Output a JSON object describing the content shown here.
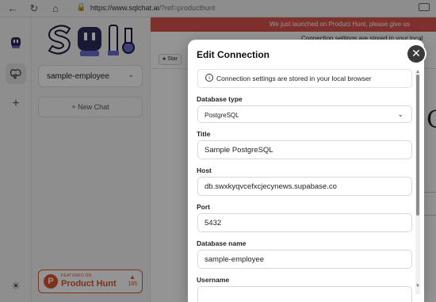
{
  "browser": {
    "url_host": "https://www.sqlchat.ai",
    "url_path": "/?ref=producthunt"
  },
  "sidebar": {
    "database_selector": "sample-employee",
    "new_chat_label": "New Chat"
  },
  "product_hunt": {
    "featured_label": "FEATURED ON",
    "name": "Product Hunt",
    "upvotes": "185"
  },
  "main": {
    "banner_text": "We just launched on Product Hunt, please give us",
    "sub_note": "Connection settings are stored in your local",
    "github_star_label": "Star",
    "background_glyph": "C"
  },
  "modal": {
    "title": "Edit Connection",
    "info_text": "Connection settings are stored in your local browser",
    "fields": {
      "database_type": {
        "label": "Database type",
        "value": "PostgreSQL"
      },
      "title": {
        "label": "Title",
        "value": "Sample PostgreSQL"
      },
      "host": {
        "label": "Host",
        "value": "db.swxkyqvcefxcjecynews.supabase.co"
      },
      "port": {
        "label": "Port",
        "value": "5432"
      },
      "database_name": {
        "label": "Database name",
        "value": "sample-employee"
      },
      "username": {
        "label": "Username"
      }
    }
  },
  "colors": {
    "banner": "#d9534f",
    "product_hunt": "#da552f",
    "close_button": "#3a3a3a"
  }
}
